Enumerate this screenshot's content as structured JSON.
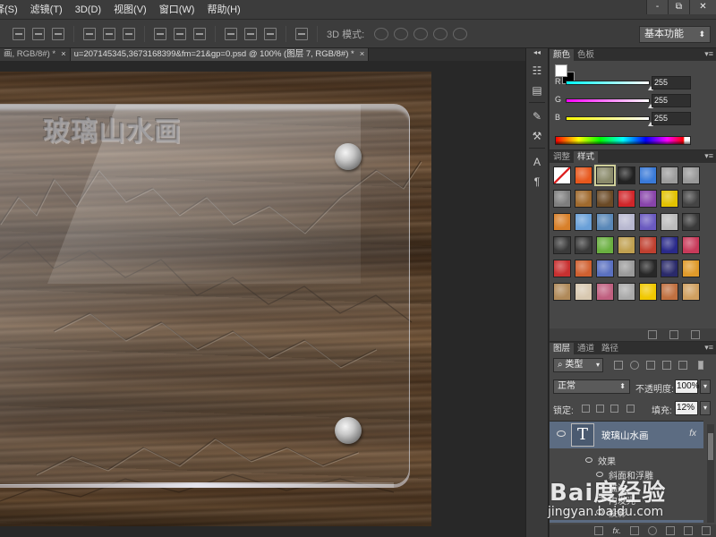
{
  "menubar": {
    "items": [
      "择(S)",
      "滤镜(T)",
      "3D(D)",
      "视图(V)",
      "窗口(W)",
      "帮助(H)"
    ]
  },
  "window_controls": [
    "-",
    "⧉",
    "✕"
  ],
  "optionsbar": {
    "mode_label": "3D 模式:",
    "workspace": "基本功能"
  },
  "doctabs": [
    {
      "label": "画, RGB/8#) *",
      "active": false
    },
    {
      "label": "u=207145345,3673168399&fm=21&gp=0.psd @ 100% (图层 7, RGB/8#) *",
      "active": true
    }
  ],
  "artwork": {
    "title": "玻璃山水画",
    "wood_color": "#5a412c"
  },
  "color_panel": {
    "tabs": [
      "颜色",
      "色板"
    ],
    "foreground": "#ffffff",
    "background": "#000000",
    "channels": [
      {
        "name": "R",
        "value": "255",
        "fill": 1.0
      },
      {
        "name": "G",
        "value": "255",
        "fill": 1.0
      },
      {
        "name": "B",
        "value": "255",
        "fill": 1.0
      }
    ]
  },
  "styles_panel": {
    "tabs": [
      "调整",
      "样式"
    ],
    "swatches": [
      "#ffffff",
      "#e8581d",
      "#8a8a6a",
      "#222222",
      "#3a7ad8",
      "#9c9c9c",
      "#999999",
      "#7e7e7e",
      "#a06a2e",
      "#6a4a26",
      "#d0262a",
      "#8844aa",
      "#e2c200",
      "#444444",
      "#d8802a",
      "#6aa0d8",
      "#5a88b8",
      "#b8b8d0",
      "#6a5ac0",
      "#bcbcbc",
      "#3a3a3a",
      "#3a3a3a",
      "#3a3a3a",
      "#6ab040",
      "#c0a050",
      "#c04030",
      "#2a2a8a",
      "#c83a5a",
      "#c83030",
      "#d06030",
      "#5a70c0",
      "#9a9a9a",
      "#282828",
      "#2a2a6a",
      "#e09a2a",
      "#b08a5a",
      "#d8c8b0",
      "#c06080",
      "#aaaaaa",
      "#f0c800",
      "#c07040",
      "#d0a060"
    ]
  },
  "layers_panel": {
    "tabs": [
      "图层",
      "通道",
      "路径"
    ],
    "filter_type": "类型",
    "blend_mode": "正常",
    "opacity_label": "不透明度:",
    "opacity_value": "100%",
    "lock_label": "锁定:",
    "fill_label": "填充:",
    "fill_value": "12%",
    "layer": {
      "name": "玻璃山水画",
      "fx": "fx",
      "thumb_letter": "T"
    },
    "effects_header": "效果",
    "effects": [
      "斜面和浮雕",
      "描边",
      "内发光",
      "投影"
    ]
  },
  "watermark": {
    "logo": "Bai度经验",
    "url": "jingyan.baidu.com"
  },
  "colors": {
    "selected_layer": "#5c6c82",
    "panel_bg": "#474747",
    "chrome_bg": "#3c3c3c"
  }
}
